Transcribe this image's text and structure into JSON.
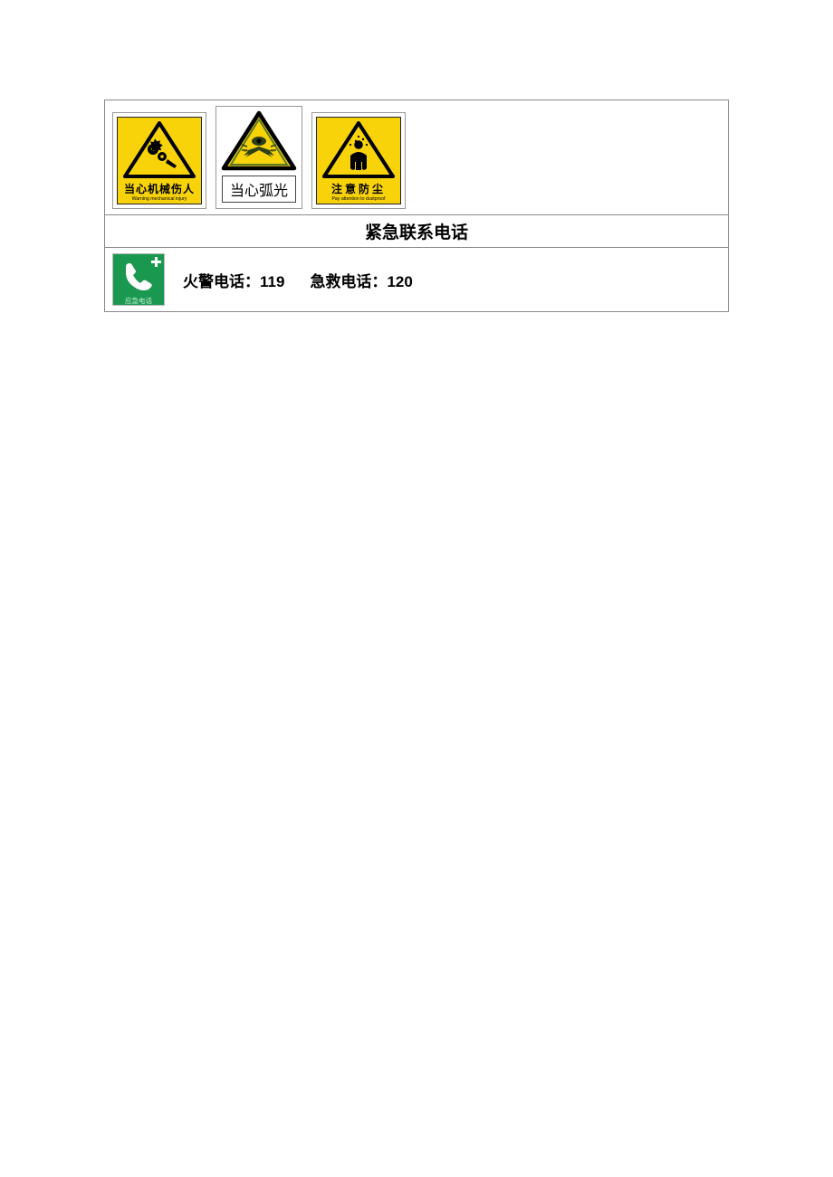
{
  "signs": [
    {
      "title": "当心机械伤人",
      "sub": "Warning mechanical injury",
      "icon": "gears-hand"
    },
    {
      "title": "当心弧光",
      "sub": "",
      "icon": "arc-light"
    },
    {
      "title": "注意防尘",
      "sub": "Pay attention to dustproof",
      "icon": "dust-mask"
    }
  ],
  "section_header": "紧急联系电话",
  "emergency": {
    "icon_label": "应急电话",
    "fire_label": "火警电话：",
    "fire_number": "119",
    "aid_label": "急救电话：",
    "aid_number": "120"
  },
  "colors": {
    "warning_yellow": "#f8d30a",
    "safety_green": "#1a9850"
  }
}
